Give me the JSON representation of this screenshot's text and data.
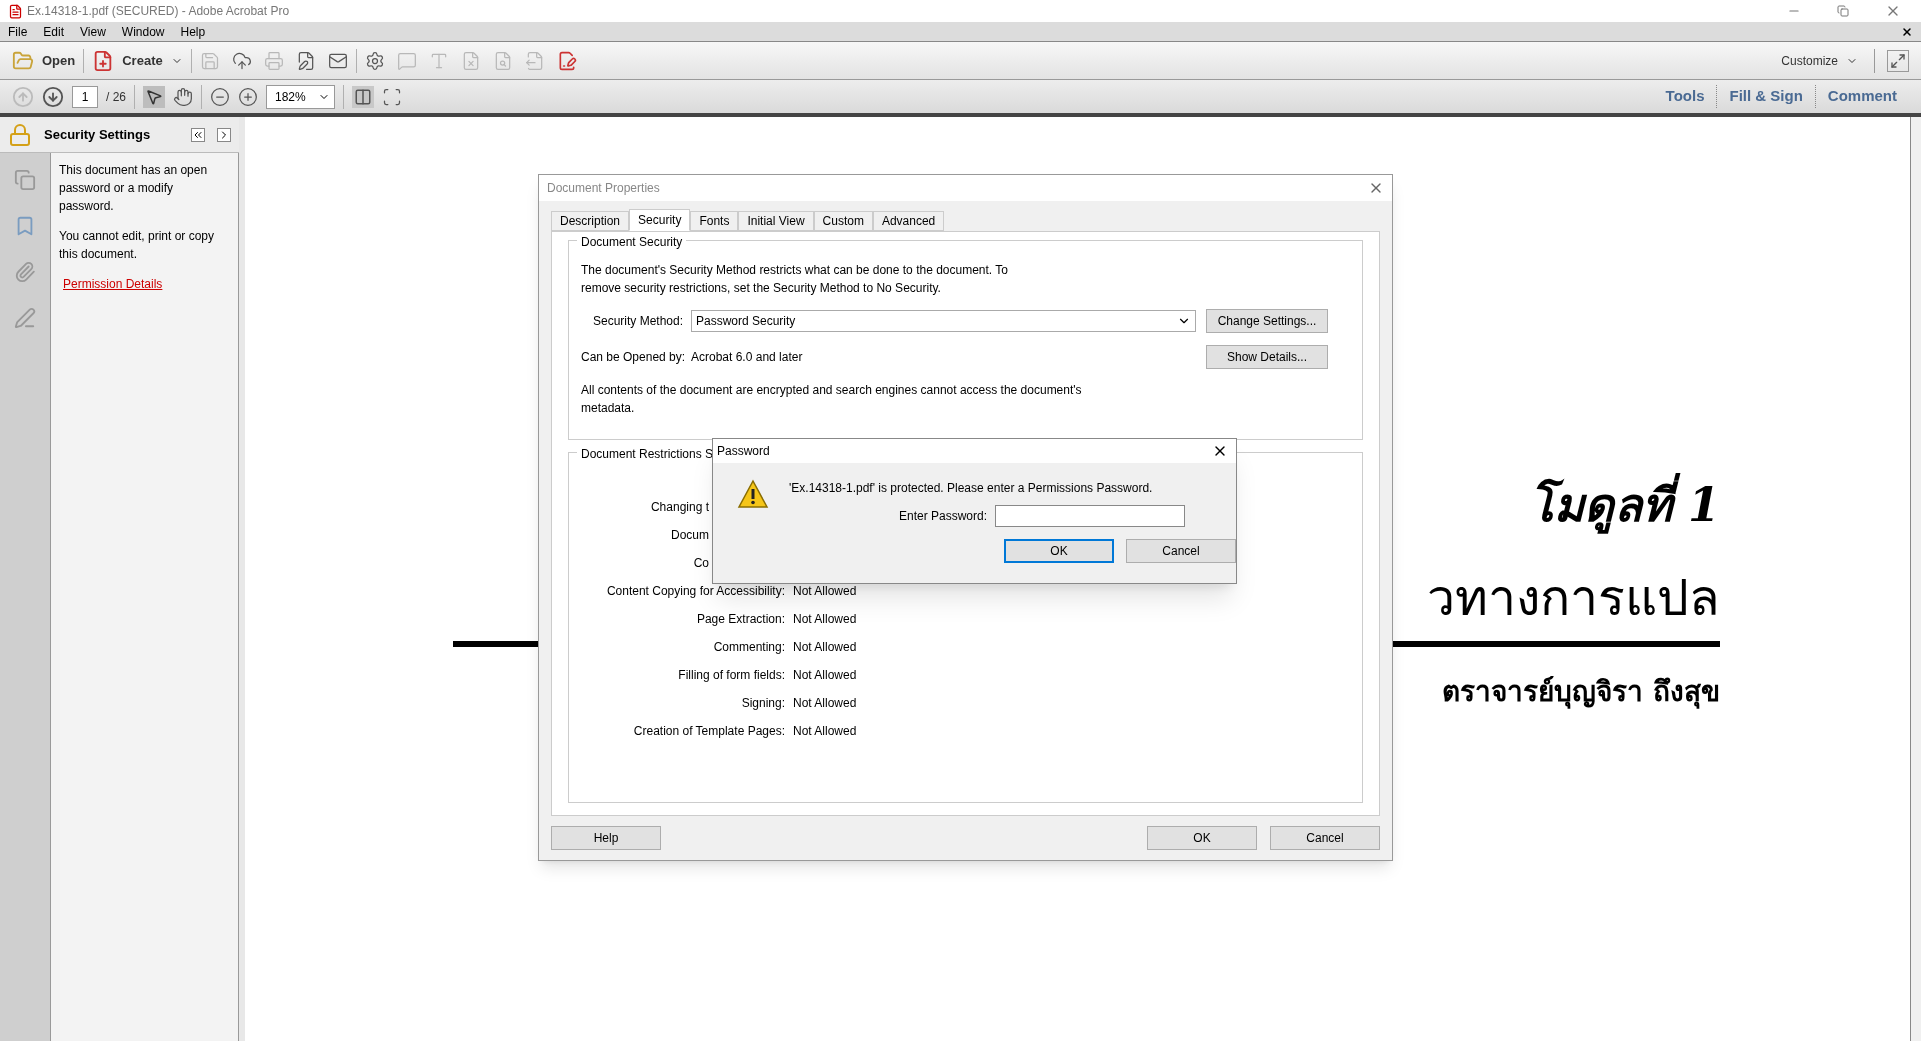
{
  "window": {
    "title": "Ex.14318-1.pdf (SECURED) - Adobe Acrobat Pro"
  },
  "menu": [
    "File",
    "Edit",
    "View",
    "Window",
    "Help"
  ],
  "toolbar": {
    "open": "Open",
    "create": "Create",
    "customize": "Customize"
  },
  "nav": {
    "page": "1",
    "page_total": "/ 26",
    "zoom": "182%"
  },
  "task_tabs": [
    "Tools",
    "Fill & Sign",
    "Comment"
  ],
  "side_panel": {
    "title": "Security Settings",
    "paragraphs": [
      "This document has an open password or a modify password.",
      "You cannot edit, print or copy this document."
    ],
    "link": "Permission Details"
  },
  "document": {
    "module": "โมดูลที่ 1",
    "heading": "วทางการแปล",
    "author": "ตราจารย์บุญจิรา ถึงสุข"
  },
  "properties_dialog": {
    "title": "Document Properties",
    "tabs": [
      {
        "label": "Description",
        "selected": false
      },
      {
        "label": "Security",
        "selected": true
      },
      {
        "label": "Fonts",
        "selected": false
      },
      {
        "label": "Initial View",
        "selected": false
      },
      {
        "label": "Custom",
        "selected": false
      },
      {
        "label": "Advanced",
        "selected": false
      }
    ],
    "security_group": {
      "title": "Document Security",
      "description": "The document's Security Method restricts what can be done to the document. To remove security restrictions, set the Security Method to No Security.",
      "method_label": "Security Method:",
      "method_value": "Password Security",
      "change_button": "Change Settings...",
      "opened_label": "Can be Opened by:",
      "opened_value": "Acrobat 6.0 and later",
      "details_button": "Show Details...",
      "note": "All contents of the document are encrypted and search engines cannot access the document's metadata."
    },
    "restrictions_group": {
      "title": "Document Restrictions S",
      "rows": [
        {
          "kind": "partial",
          "label": "Changing t"
        },
        {
          "kind": "partial",
          "label": "Docum"
        },
        {
          "kind": "partial",
          "label": "Co"
        },
        {
          "kind": "full",
          "label": "Content Copying for Accessibility:",
          "value": "Not Allowed"
        },
        {
          "kind": "full",
          "label": "Page Extraction:",
          "value": "Not Allowed"
        },
        {
          "kind": "full",
          "label": "Commenting:",
          "value": "Not Allowed"
        },
        {
          "kind": "full",
          "label": "Filling of form fields:",
          "value": "Not Allowed"
        },
        {
          "kind": "full",
          "label": "Signing:",
          "value": "Not Allowed"
        },
        {
          "kind": "full",
          "label": "Creation of Template Pages:",
          "value": "Not Allowed"
        }
      ]
    },
    "buttons": {
      "help": "Help",
      "ok": "OK",
      "cancel": "Cancel"
    }
  },
  "password_dialog": {
    "title": "Password",
    "message": "'Ex.14318-1.pdf' is protected. Please enter a Permissions Password.",
    "field_label": "Enter Password:",
    "ok": "OK",
    "cancel": "Cancel"
  }
}
